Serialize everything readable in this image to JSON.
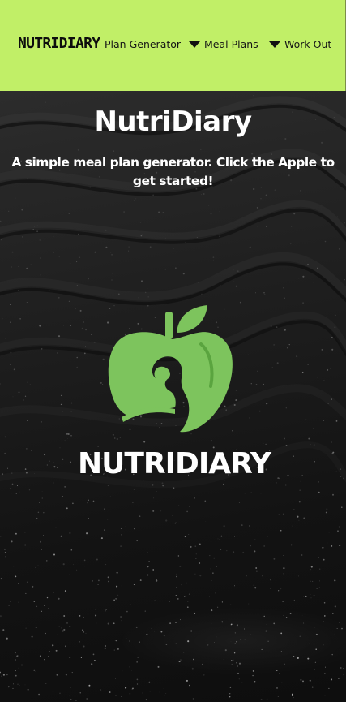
{
  "nav": {
    "brand": "NUTRIDIARY",
    "links": [
      {
        "label": "Plan Generator",
        "has_dropdown": false
      },
      {
        "label": "Meal Plans",
        "has_dropdown": true,
        "icon": "caret-down-icon"
      },
      {
        "label": "Work Out",
        "has_dropdown": true,
        "icon": "caret-down-icon"
      }
    ],
    "background_color": "#c1ef67"
  },
  "hero": {
    "title": "NutriDiary",
    "subtitle": "A simple meal plan generator. Click the Apple to get started!",
    "logo": {
      "icon": "apple-logo-icon",
      "text": "NUTRIDIARY",
      "color": "#7dc45d"
    }
  }
}
